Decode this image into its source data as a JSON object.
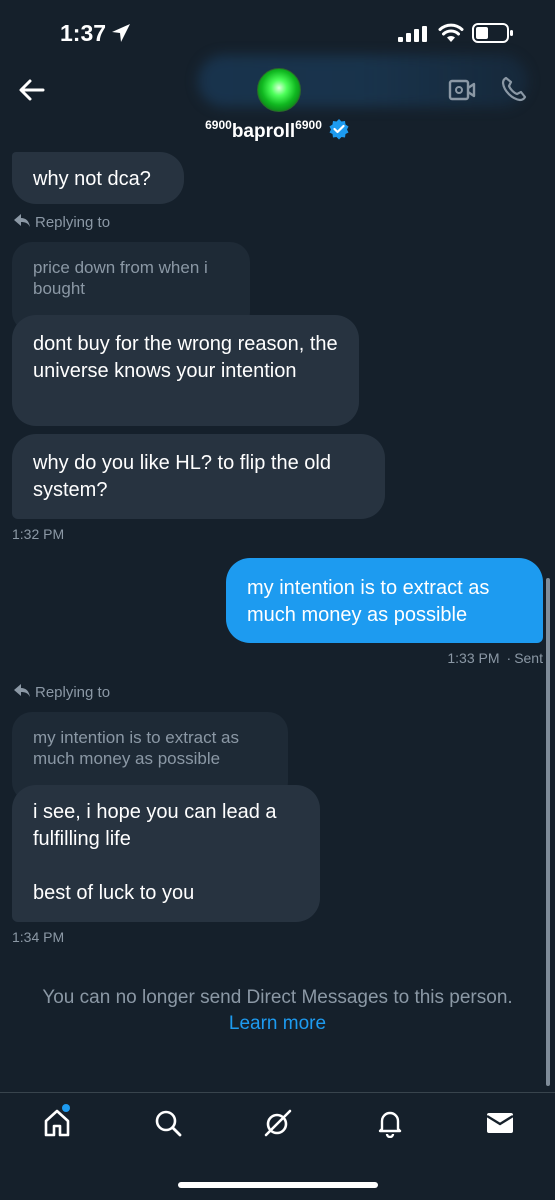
{
  "status_bar": {
    "time": "1:37"
  },
  "header": {
    "username_prefix": "6900",
    "username_main": "baproll",
    "username_suffix": "6900"
  },
  "messages": [
    {
      "text": "why not dca?"
    },
    {
      "reply_label": "Replying to",
      "quoted": "price down from when i bought",
      "text": "dont buy for the wrong reason, the universe knows your intention"
    },
    {
      "text": "why do you like HL? to flip the old system?",
      "time": "1:32 PM"
    },
    {
      "text": "my intention is to extract as much money as possible",
      "time": "1:33 PM",
      "status": "Sent"
    },
    {
      "reply_label": "Replying to",
      "quoted": "my intention is to extract as much money as possible",
      "text_line1": "i see, i hope you can lead a fulfilling life",
      "text_line2": "best of luck to you",
      "time": "1:34 PM"
    }
  ],
  "notice": {
    "text": "You can no longer send Direct Messages to this person.",
    "link": "Learn more"
  },
  "nav": {
    "items": [
      "home-icon",
      "search-icon",
      "grok-icon",
      "bell-icon",
      "mail-icon"
    ],
    "home_has_notification": true
  },
  "colors": {
    "background": "#15202b",
    "incoming_bubble": "#273340",
    "outgoing_bubble": "#1d9bf0",
    "muted_text": "#8b98a5",
    "verified": "#1d9bf0"
  }
}
